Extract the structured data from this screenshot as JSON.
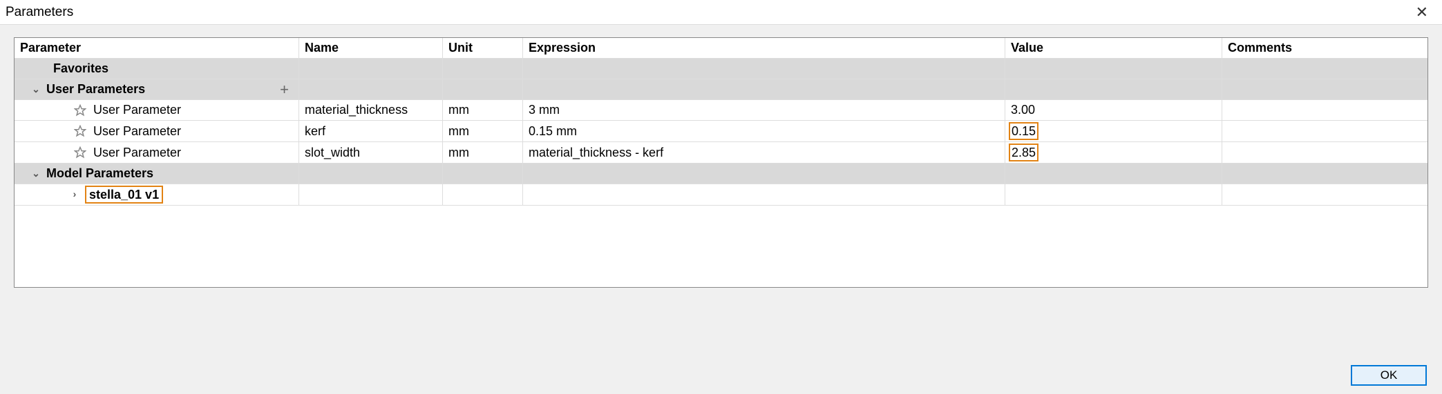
{
  "window": {
    "title": "Parameters",
    "ok_label": "OK"
  },
  "columns": {
    "parameter": "Parameter",
    "name": "Name",
    "unit": "Unit",
    "expression": "Expression",
    "value": "Value",
    "comments": "Comments"
  },
  "groups": {
    "favorites": "Favorites",
    "user": "User Parameters",
    "model": "Model Parameters",
    "model_child": "stella_01 v1"
  },
  "rows": [
    {
      "label": "User Parameter",
      "name": "material_thickness",
      "unit": "mm",
      "expression": "3 mm",
      "value": "3.00",
      "highlighted": false
    },
    {
      "label": "User Parameter",
      "name": "kerf",
      "unit": "mm",
      "expression": "0.15 mm",
      "value": "0.15",
      "highlighted": true
    },
    {
      "label": "User Parameter",
      "name": "slot_width",
      "unit": "mm",
      "expression": "material_thickness - kerf",
      "value": "2.85",
      "highlighted": true
    }
  ]
}
